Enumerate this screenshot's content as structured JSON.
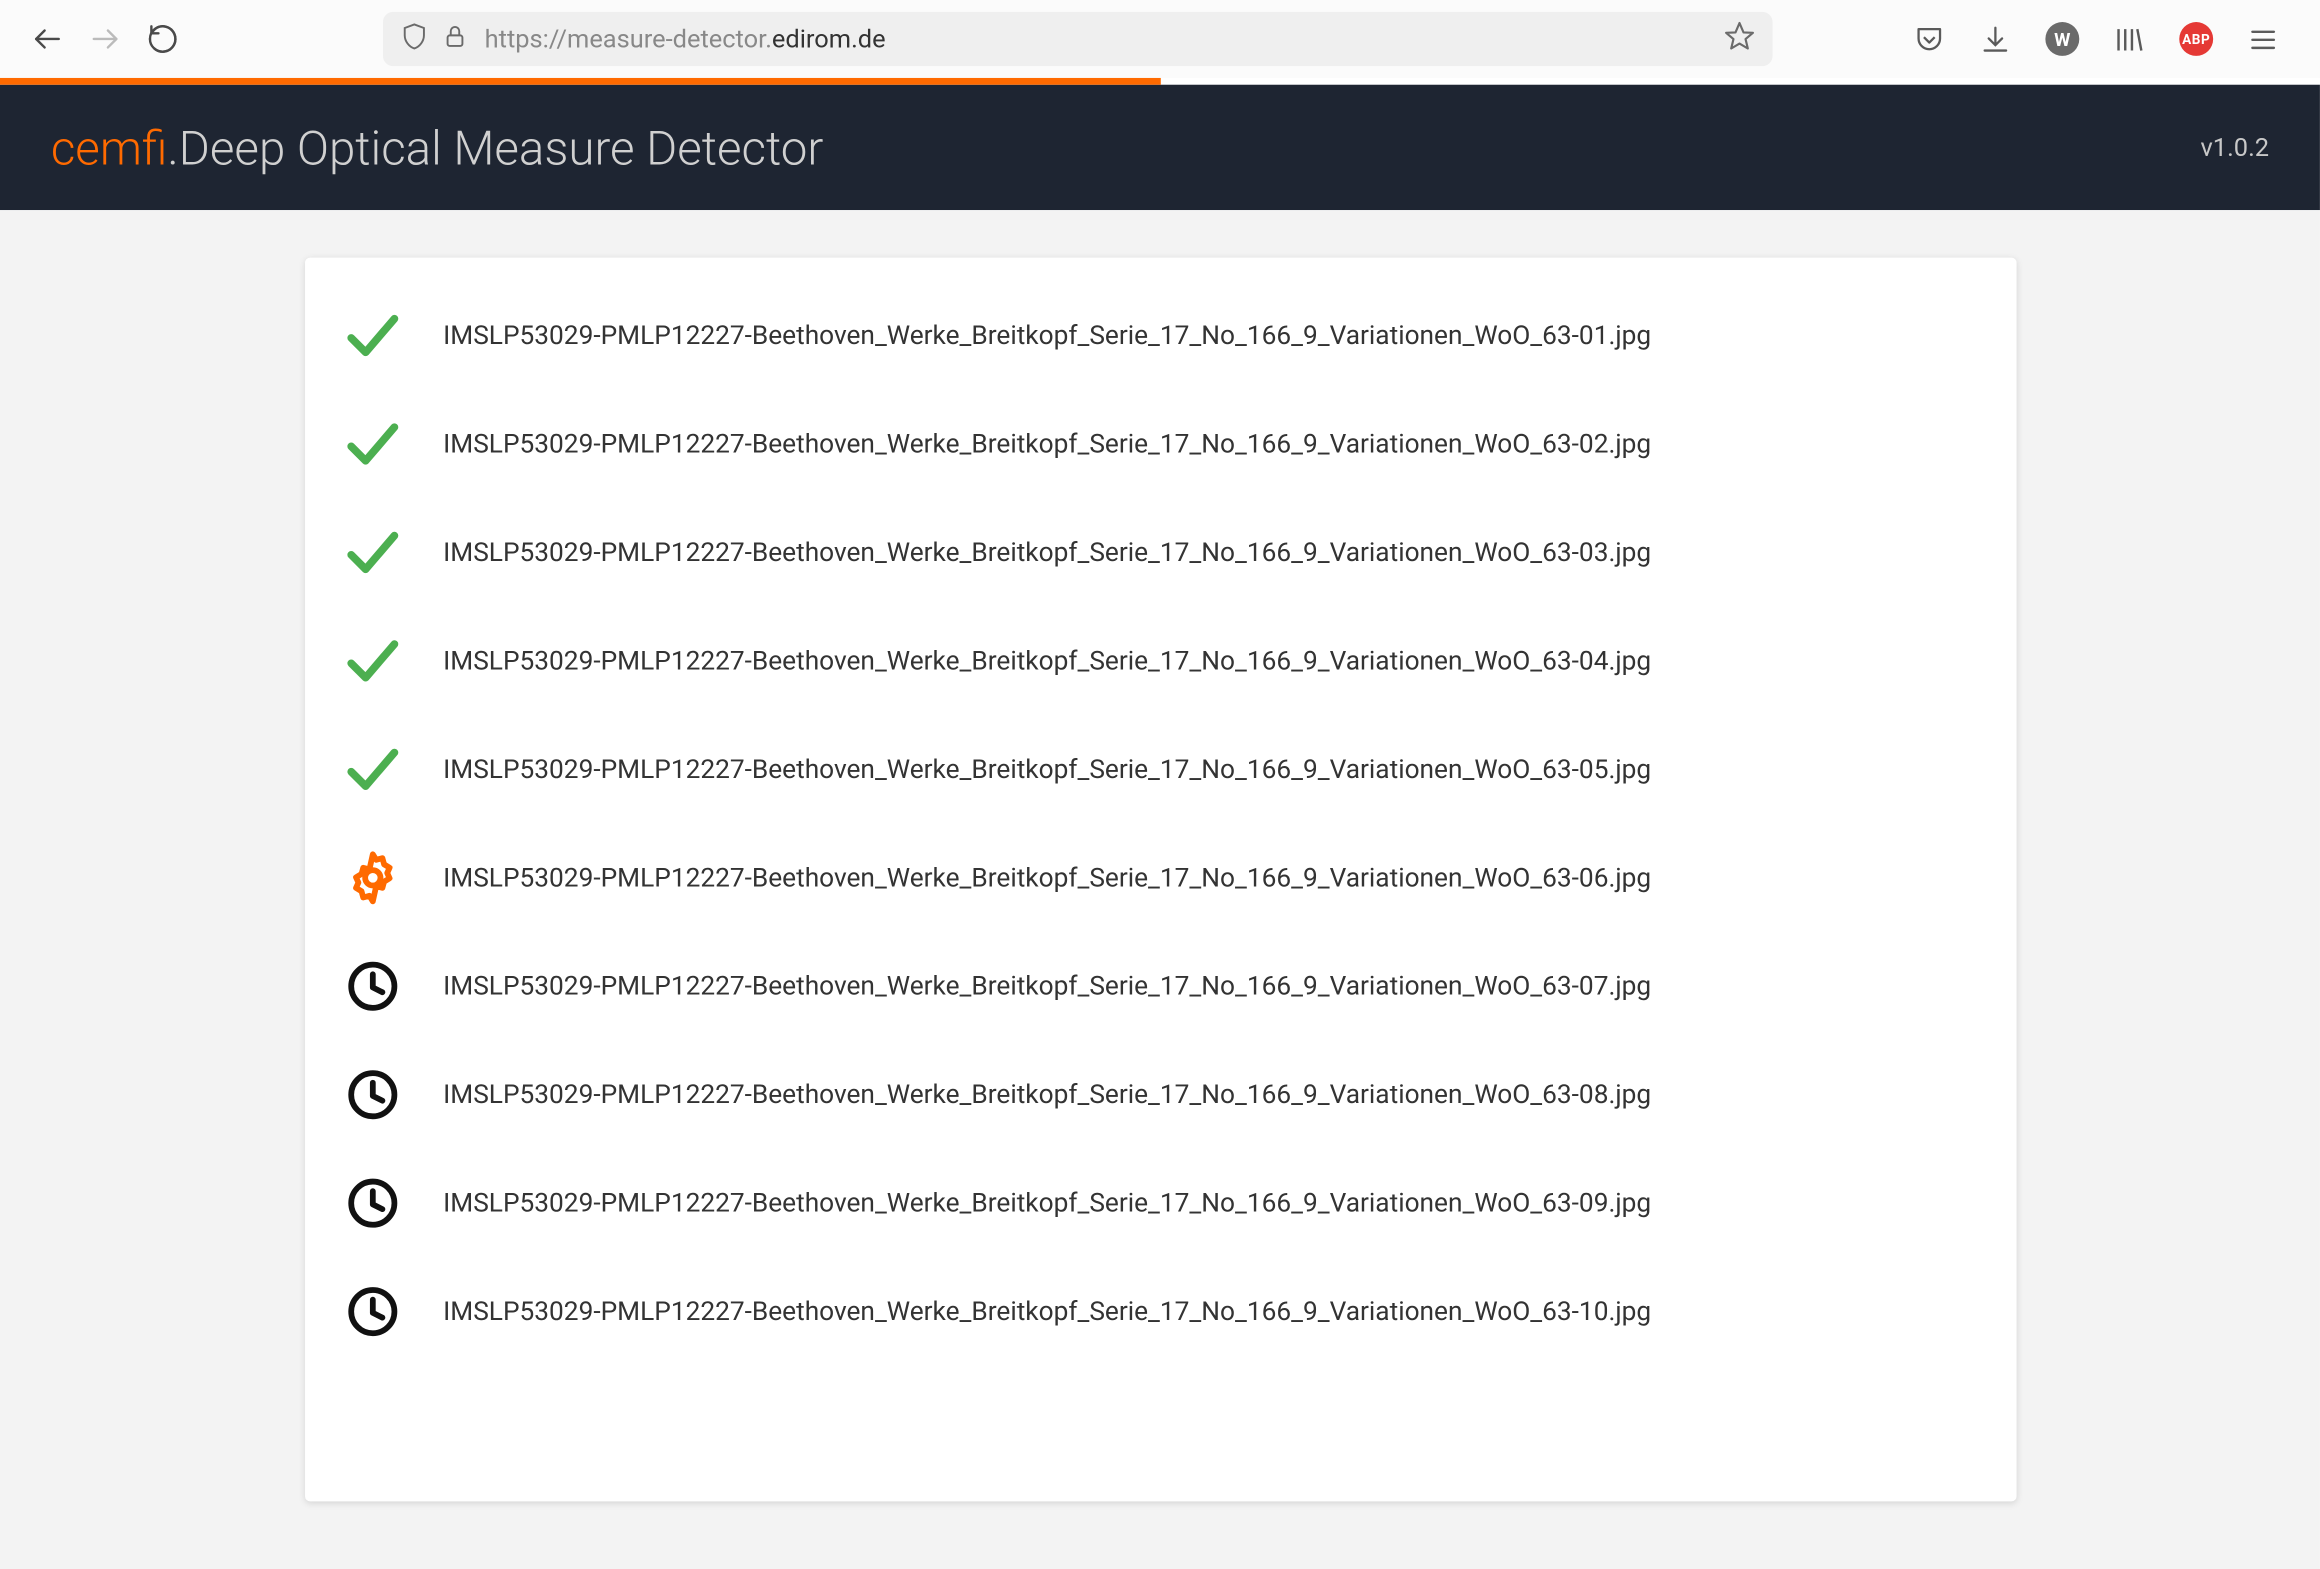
{
  "browser": {
    "url_prefix": "https://measure-detector.",
    "url_domain": "edirom.de"
  },
  "header": {
    "brand": "cemfi",
    "separator": ".",
    "title": "Deep Optical Measure Detector",
    "version": "v1.0.2"
  },
  "files": [
    {
      "status": "done",
      "name": "IMSLP53029-PMLP12227-Beethoven_Werke_Breitkopf_Serie_17_No_166_9_Variationen_WoO_63-01.jpg"
    },
    {
      "status": "done",
      "name": "IMSLP53029-PMLP12227-Beethoven_Werke_Breitkopf_Serie_17_No_166_9_Variationen_WoO_63-02.jpg"
    },
    {
      "status": "done",
      "name": "IMSLP53029-PMLP12227-Beethoven_Werke_Breitkopf_Serie_17_No_166_9_Variationen_WoO_63-03.jpg"
    },
    {
      "status": "done",
      "name": "IMSLP53029-PMLP12227-Beethoven_Werke_Breitkopf_Serie_17_No_166_9_Variationen_WoO_63-04.jpg"
    },
    {
      "status": "done",
      "name": "IMSLP53029-PMLP12227-Beethoven_Werke_Breitkopf_Serie_17_No_166_9_Variationen_WoO_63-05.jpg"
    },
    {
      "status": "processing",
      "name": "IMSLP53029-PMLP12227-Beethoven_Werke_Breitkopf_Serie_17_No_166_9_Variationen_WoO_63-06.jpg"
    },
    {
      "status": "pending",
      "name": "IMSLP53029-PMLP12227-Beethoven_Werke_Breitkopf_Serie_17_No_166_9_Variationen_WoO_63-07.jpg"
    },
    {
      "status": "pending",
      "name": "IMSLP53029-PMLP12227-Beethoven_Werke_Breitkopf_Serie_17_No_166_9_Variationen_WoO_63-08.jpg"
    },
    {
      "status": "pending",
      "name": "IMSLP53029-PMLP12227-Beethoven_Werke_Breitkopf_Serie_17_No_166_9_Variationen_WoO_63-09.jpg"
    },
    {
      "status": "pending",
      "name": "IMSLP53029-PMLP12227-Beethoven_Werke_Breitkopf_Serie_17_No_166_9_Variationen_WoO_63-10.jpg"
    }
  ],
  "colors": {
    "accent": "#ff6a00",
    "done": "#4caf50",
    "processing": "#ff6a00",
    "pending": "#111"
  }
}
